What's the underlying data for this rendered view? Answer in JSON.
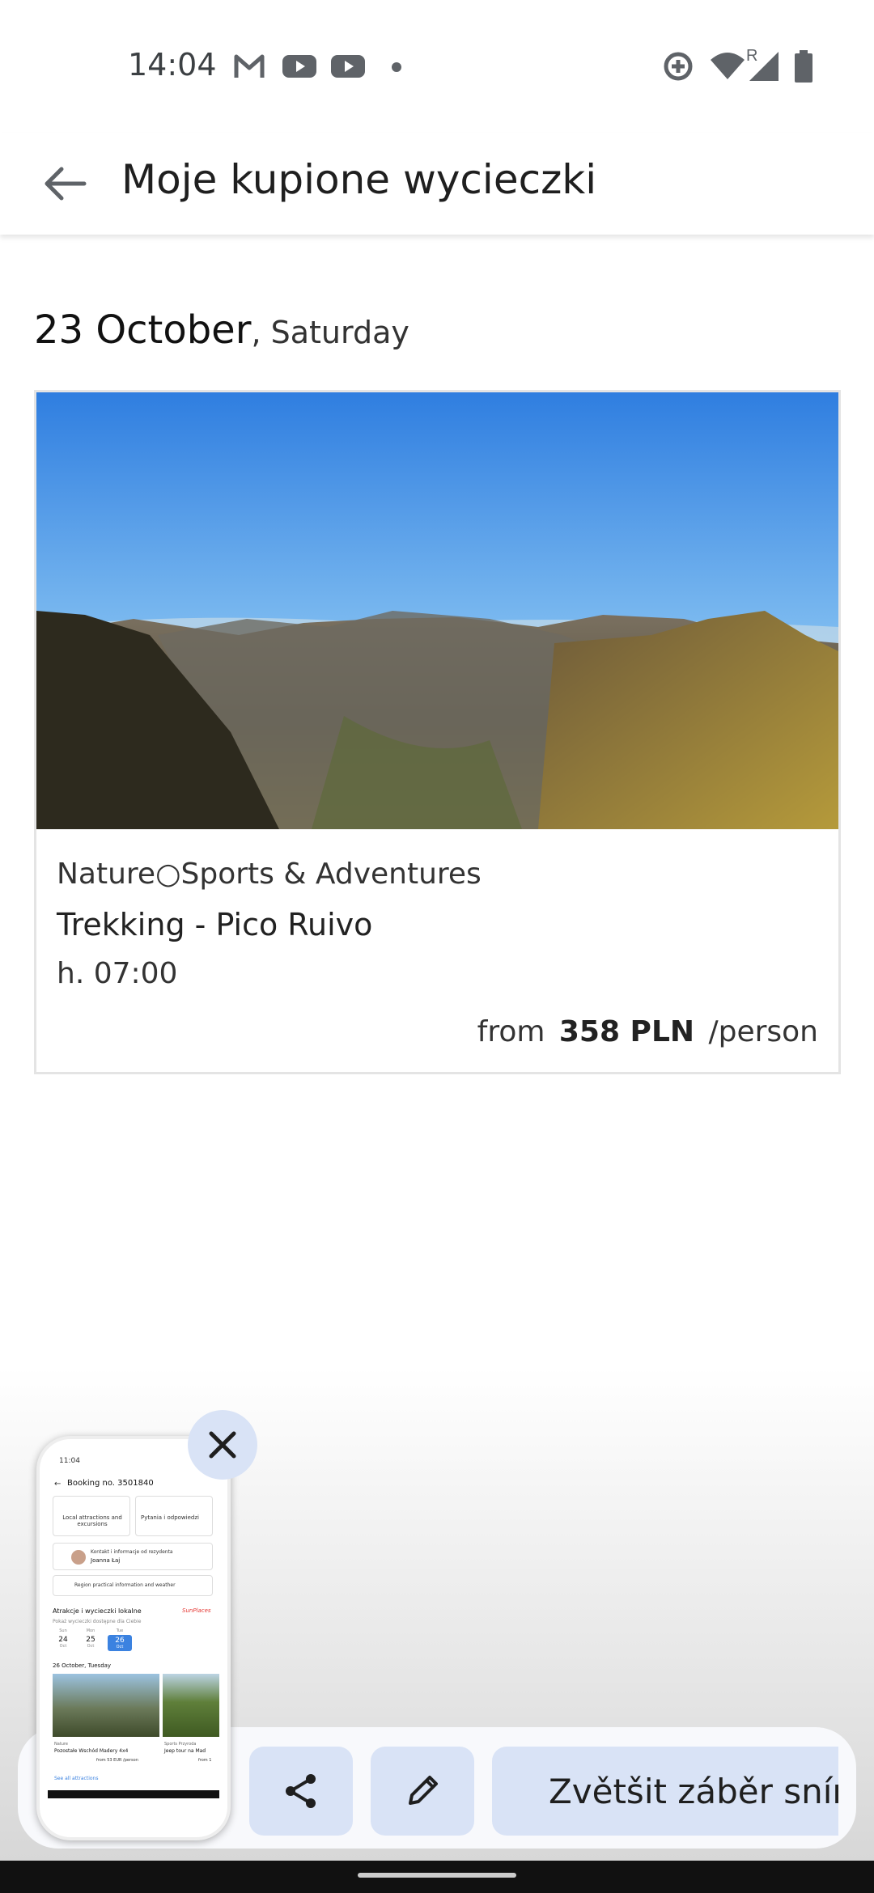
{
  "status_bar": {
    "time": "14:04",
    "icons": [
      "gmail-icon",
      "youtube-icon",
      "youtube-icon",
      "dot-icon",
      "data-saver-icon",
      "wifi-icon",
      "signal-icon",
      "battery-icon"
    ],
    "roaming": "R"
  },
  "app_bar": {
    "title": "Moje kupione wycieczki"
  },
  "day": {
    "date": "23 October",
    "weekday": ", Saturday"
  },
  "excursion": {
    "category": "Nature○Sports & Adventures",
    "name": "Trekking - Pico Ruivo",
    "time": "h. 07:00",
    "price_prefix": "from",
    "price": "358 PLN",
    "price_suffix": "/person"
  },
  "screenshot_toolbar": {
    "expand_label": "Zvětšit záběr sním"
  },
  "preview": {
    "time": "11:04",
    "title": "Booking no. 3501840",
    "tile_left": "Local attractions and excursions",
    "tile_right": "Pytania i odpowiedzi",
    "contact_line1": "Kontakt i informacje od rezydenta",
    "contact_line2": "Joanna Łaj",
    "region_info": "Region practical information and weather",
    "section_title": "Atrakcje i wycieczki lokalne",
    "brand": "SunPlaces",
    "subtitle": "Pokaż wycieczki dostępne dla Ciebie",
    "days": [
      {
        "dow": "Sun",
        "num": "24",
        "mon": "Oct"
      },
      {
        "dow": "Mon",
        "num": "25",
        "mon": "Oct"
      },
      {
        "dow": "Tue",
        "num": "26",
        "mon": "Oct"
      }
    ],
    "list_date": "26 October, Tuesday",
    "item1_line1": "Nature",
    "item1_line2": "Pozostałe Wschód Madery 4x4",
    "item1_price": "from 53 EUR /person",
    "item2_line1": "Sports Przyroda",
    "item2_line2": "Jeep tour na Mad",
    "item2_price": "from 1",
    "footer_link": "See all attractions"
  },
  "colors": {
    "accent_button": "#d9e3f6",
    "selected_day": "#3b82e0",
    "brand_red": "#e53935"
  }
}
